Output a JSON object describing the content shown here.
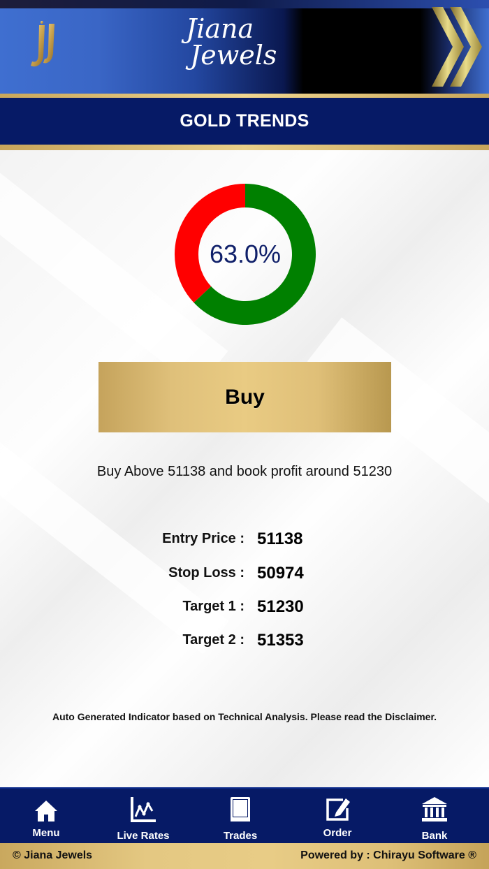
{
  "header": {
    "brand_line1": "Jiana",
    "brand_line2": "Jewels"
  },
  "page": {
    "title": "GOLD TRENDS"
  },
  "trend": {
    "percent_label": "63.0%",
    "buy_fraction": 0.63,
    "sell_fraction": 0.37,
    "buy_color": "#008000",
    "sell_color": "#ff0000",
    "signal_label": "Buy",
    "advice": "Buy Above 51138 and book profit around 51230"
  },
  "levels": [
    {
      "label": "Entry Price :",
      "value": "51138"
    },
    {
      "label": "Stop Loss :",
      "value": "50974"
    },
    {
      "label": "Target 1 :",
      "value": "51230"
    },
    {
      "label": "Target 2 :",
      "value": "51353"
    }
  ],
  "disclaimer": "Auto Generated Indicator based on Technical Analysis. Please read the Disclaimer.",
  "nav": [
    {
      "label": "Menu",
      "icon": "home-icon"
    },
    {
      "label": "Live Rates",
      "icon": "chart-icon"
    },
    {
      "label": "Trades",
      "icon": "book-icon"
    },
    {
      "label": "Order",
      "icon": "edit-icon"
    },
    {
      "label": "Bank",
      "icon": "bank-icon"
    }
  ],
  "footer": {
    "copyright": "© Jiana Jewels",
    "powered_by": "Powered by : Chirayu Software ®"
  },
  "colors": {
    "navy": "#061a66",
    "gold": "#e4c882",
    "header_blue": "#3f6fd0"
  }
}
